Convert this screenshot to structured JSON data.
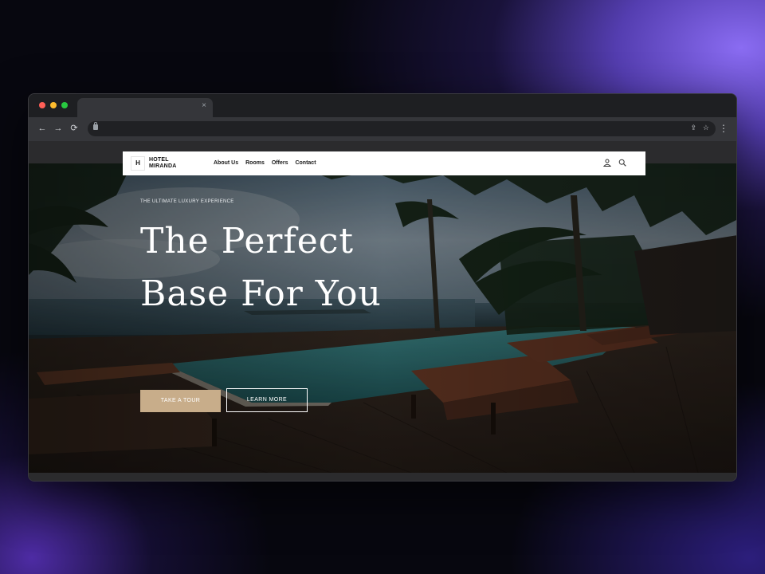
{
  "browser": {
    "tab_close": "×",
    "nav": {
      "back": "←",
      "forward": "→",
      "reload": "⟳"
    },
    "omnibox": {
      "share": "⇪",
      "bookmark": "☆"
    },
    "menu": "⋮"
  },
  "site": {
    "logo_mark": "H",
    "logo_line1": "HOTEL",
    "logo_line2": "MIRANDA",
    "nav": [
      "About Us",
      "Rooms",
      "Offers",
      "Contact"
    ]
  },
  "hero": {
    "eyebrow": "THE ULTIMATE LUXURY EXPERIENCE",
    "headline_line1": "The Perfect",
    "headline_line2": "Base For You",
    "primary_button": "TAKE A TOUR",
    "secondary_button": "LEARN MORE"
  },
  "colors": {
    "accent_button": "#c8ad8a",
    "header_bg": "#ffffff",
    "pool_water": "#2f6f73"
  },
  "icons": [
    "user-icon",
    "search-icon",
    "lock-icon",
    "share-icon",
    "star-icon",
    "kebab-menu-icon"
  ]
}
